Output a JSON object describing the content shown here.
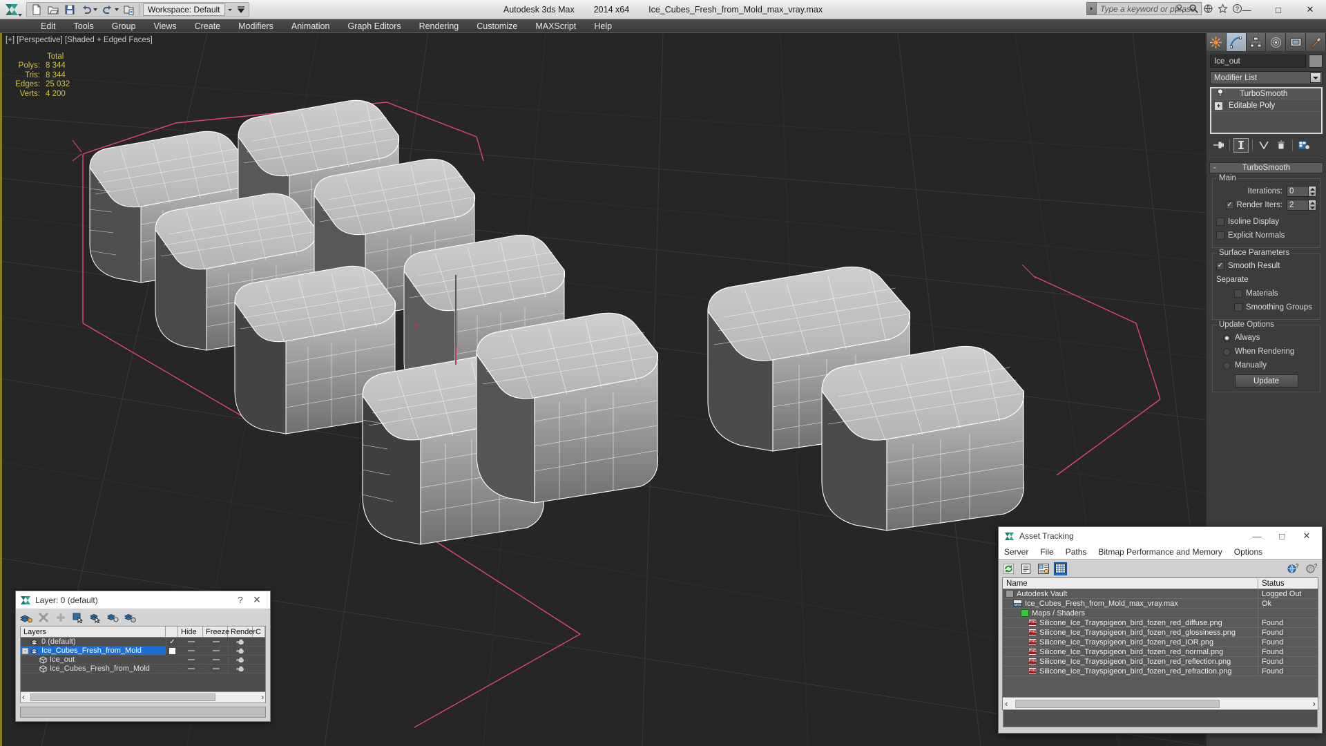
{
  "titlebar": {
    "app_name": "Autodesk 3ds Max",
    "version": "2014 x64",
    "document": "Ice_Cubes_Fresh_from_Mold_max_vray.max",
    "workspace_label": "Workspace: Default",
    "quick_access": [
      {
        "name": "new-file-icon",
        "label": "New"
      },
      {
        "name": "open-file-icon",
        "label": "Open"
      },
      {
        "name": "save-file-icon",
        "label": "Save"
      },
      {
        "name": "undo-icon",
        "label": "Undo"
      },
      {
        "name": "redo-icon",
        "label": "Redo"
      },
      {
        "name": "set-project-folder-icon",
        "label": "Set Project Folder"
      }
    ],
    "search_placeholder": "Type a keyword or phrase",
    "title_icons": [
      {
        "name": "sign-in-icon"
      },
      {
        "name": "search-icon"
      },
      {
        "name": "communication-center-icon"
      },
      {
        "name": "favorites-icon"
      },
      {
        "name": "help-icon"
      }
    ],
    "window_controls": {
      "minimize": "—",
      "maximize": "□",
      "close": "✕"
    }
  },
  "menubar": {
    "items": [
      "Edit",
      "Tools",
      "Group",
      "Views",
      "Create",
      "Modifiers",
      "Animation",
      "Graph Editors",
      "Rendering",
      "Customize",
      "MAXScript",
      "Help"
    ]
  },
  "viewport": {
    "label": "[+] [Perspective] [Shaded + Edged Faces]",
    "stats": {
      "header": "Total",
      "rows": [
        {
          "key": "Polys:",
          "value": "8 344"
        },
        {
          "key": "Tris:",
          "value": "8 344"
        },
        {
          "key": "Edges:",
          "value": "25 032"
        },
        {
          "key": "Verts:",
          "value": "4 200"
        }
      ]
    }
  },
  "command_panel": {
    "tabs": [
      {
        "name": "create-tab",
        "label": "Create"
      },
      {
        "name": "modify-tab",
        "label": "Modify",
        "active": true
      },
      {
        "name": "hierarchy-tab",
        "label": "Hierarchy"
      },
      {
        "name": "motion-tab",
        "label": "Motion"
      },
      {
        "name": "display-tab",
        "label": "Display"
      },
      {
        "name": "utilities-tab",
        "label": "Utilities"
      }
    ],
    "object_name": "Ice_out",
    "modifier_list_label": "Modifier List",
    "stack": [
      {
        "label": "TurboSmooth",
        "icon": "lightbulb-icon",
        "selected": true
      },
      {
        "label": "Editable Poly",
        "icon": "expand-plus-icon",
        "selected": false
      }
    ],
    "stack_tools": [
      {
        "name": "pin-stack-icon"
      },
      {
        "name": "show-end-result-icon"
      },
      {
        "name": "make-unique-icon"
      },
      {
        "name": "remove-modifier-icon"
      },
      {
        "name": "configure-modifier-sets-icon"
      }
    ],
    "rollout": {
      "title": "TurboSmooth",
      "collapse_glyph": "-",
      "main": {
        "label": "Main",
        "iterations_label": "Iterations:",
        "iterations_value": "0",
        "render_iters_label": "Render Iters:",
        "render_iters_value": "2",
        "render_iters_checked": true,
        "isoline_display_label": "Isoline Display",
        "isoline_display_checked": false,
        "explicit_normals_label": "Explicit Normals",
        "explicit_normals_checked": false
      },
      "surface": {
        "label": "Surface Parameters",
        "smooth_result_label": "Smooth Result",
        "smooth_result_checked": true,
        "separate_label": "Separate",
        "materials_label": "Materials",
        "materials_checked": false,
        "smoothing_groups_label": "Smoothing Groups",
        "smoothing_groups_checked": false
      },
      "update": {
        "label": "Update Options",
        "options": [
          {
            "label": "Always",
            "selected": true
          },
          {
            "label": "When Rendering",
            "selected": false
          },
          {
            "label": "Manually",
            "selected": false
          }
        ],
        "button_label": "Update"
      }
    }
  },
  "layer_dialog": {
    "title": "Layer: 0 (default)",
    "help_glyph": "?",
    "close_glyph": "✕",
    "toolbar": [
      {
        "name": "create-new-layer-icon"
      },
      {
        "name": "delete-layer-icon"
      },
      {
        "name": "add-selection-to-layer-icon"
      },
      {
        "name": "select-objects-in-layer-icon"
      },
      {
        "name": "highlight-selected-objects-layer-icon"
      },
      {
        "name": "set-current-layer-icon"
      },
      {
        "name": "layer-properties-icon"
      }
    ],
    "columns": [
      "Layers",
      "",
      "Hide",
      "Freeze",
      "Render",
      "C"
    ],
    "rows": [
      {
        "name": "0 (default)",
        "indent": 1,
        "icon": "layer-icon",
        "current": true,
        "selected": false,
        "expand": ""
      },
      {
        "name": "Ice_Cubes_Fresh_from_Mold",
        "indent": 1,
        "icon": "layer-icon",
        "current": false,
        "selected": true,
        "expand": "-"
      },
      {
        "name": "Ice_out",
        "indent": 2,
        "icon": "object-icon",
        "current": false,
        "selected": false,
        "expand": ""
      },
      {
        "name": "Ice_Cubes_Fresh_from_Mold",
        "indent": 2,
        "icon": "object-icon",
        "current": false,
        "selected": false,
        "expand": ""
      }
    ]
  },
  "asset_tracking": {
    "title": "Asset Tracking",
    "window_controls": {
      "minimize": "—",
      "maximize": "□",
      "close": "✕"
    },
    "menu": [
      "Server",
      "File",
      "Paths",
      "Bitmap Performance and Memory",
      "Options"
    ],
    "toolbar": [
      {
        "name": "refresh-icon",
        "active": false
      },
      {
        "name": "list-view-icon",
        "active": false
      },
      {
        "name": "details-view-icon",
        "active": false
      },
      {
        "name": "grid-view-icon",
        "active": true
      }
    ],
    "toolbar_right": [
      {
        "name": "help-globe-icon"
      },
      {
        "name": "help-question-icon"
      }
    ],
    "columns": [
      "Name",
      "Status"
    ],
    "rows": [
      {
        "name": "Autodesk Vault",
        "status": "Logged Out",
        "indent": 1,
        "icon": "vault-icon"
      },
      {
        "name": "Ice_Cubes_Fresh_from_Mold_max_vray.max",
        "status": "Ok",
        "indent": 2,
        "icon": "max-file-icon"
      },
      {
        "name": "Maps / Shaders",
        "status": "",
        "indent": 3,
        "icon": "maps-shaders-icon"
      },
      {
        "name": "Silicone_Ice_Trayspigeon_bird_fozen_red_diffuse.png",
        "status": "Found",
        "indent": 4,
        "icon": "png-file-icon"
      },
      {
        "name": "Silicone_Ice_Trayspigeon_bird_fozen_red_glossiness.png",
        "status": "Found",
        "indent": 4,
        "icon": "png-file-icon"
      },
      {
        "name": "Silicone_Ice_Trayspigeon_bird_fozen_red_IOR.png",
        "status": "Found",
        "indent": 4,
        "icon": "png-file-icon"
      },
      {
        "name": "Silicone_Ice_Trayspigeon_bird_fozen_red_normal.png",
        "status": "Found",
        "indent": 4,
        "icon": "png-file-icon"
      },
      {
        "name": "Silicone_Ice_Trayspigeon_bird_fozen_red_reflection.png",
        "status": "Found",
        "indent": 4,
        "icon": "png-file-icon"
      },
      {
        "name": "Silicone_Ice_Trayspigeon_bird_fozen_red_refraction.png",
        "status": "Found",
        "indent": 4,
        "icon": "png-file-icon"
      }
    ],
    "scroll_left_glyph": "‹",
    "scroll_right_glyph": "›"
  },
  "colors": {
    "accent_yellow": "#d2c33d",
    "selection_blue": "#1b6fd4",
    "viewport_bg": "#262626",
    "panel_bg": "#3c3c3c",
    "gizmo_pink": "#e0447d"
  }
}
